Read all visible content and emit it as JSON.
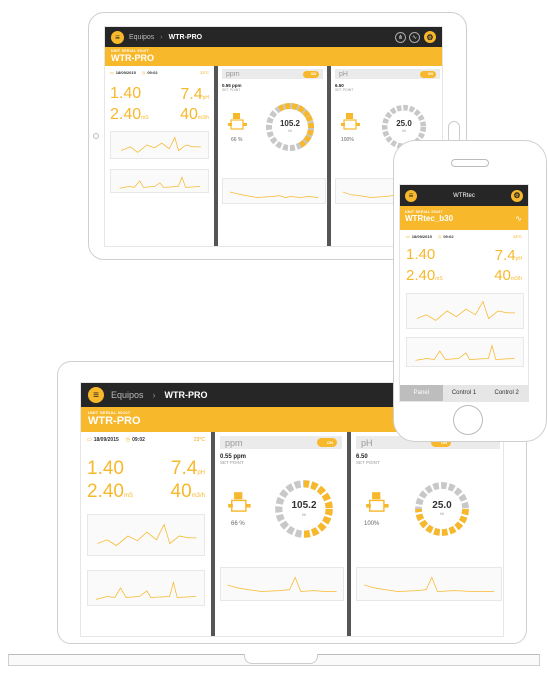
{
  "app": {
    "breadcrumb_prev": "Equipos",
    "breadcrumb_current": "WTR-PRO",
    "serial_label": "UNIT SERIAL 00107",
    "unit_title": "WTR-PRO",
    "date": "18/09/2015",
    "time": "09:02",
    "temperature": "23°C",
    "reading_1": "1.40",
    "reading_ph": "7.4",
    "reading_ph_unit": "pH",
    "reading_ms": "2.40",
    "reading_ms_unit": "mS",
    "reading_flow": "40",
    "reading_flow_unit": "m3/h",
    "ppm_panel": {
      "title": "ppm",
      "toggle": "ON",
      "set_value": "0.55 ppm",
      "set_label": "SET POINT",
      "gauge_value": "105.2",
      "gauge_unit": "l/h",
      "percent": "66 %"
    },
    "ph_panel": {
      "title": "pH",
      "toggle": "ON",
      "set_value": "6.50",
      "set_label": "SET POINT",
      "gauge_value": "25.0",
      "gauge_unit": "l/h",
      "percent": "100%"
    }
  },
  "phone_app": {
    "header_title": "WTRtec",
    "serial_label": "UNIT SERIAL 00107",
    "unit_title": "WTRtec_b30",
    "date": "18/09/2015",
    "time": "09:02",
    "temperature": "23°C",
    "reading_1": "1.40",
    "reading_ph": "7.4",
    "reading_ph_unit": "pH",
    "reading_ms": "2.40",
    "reading_ms_unit": "mS",
    "reading_flow": "40",
    "reading_flow_unit": "m3/h",
    "tabs": [
      "Panel",
      "Control 1",
      "Control 2"
    ]
  },
  "colors": {
    "accent": "#f7b82b",
    "header": "#262626",
    "gauge_gray": "#c8c8c8"
  }
}
